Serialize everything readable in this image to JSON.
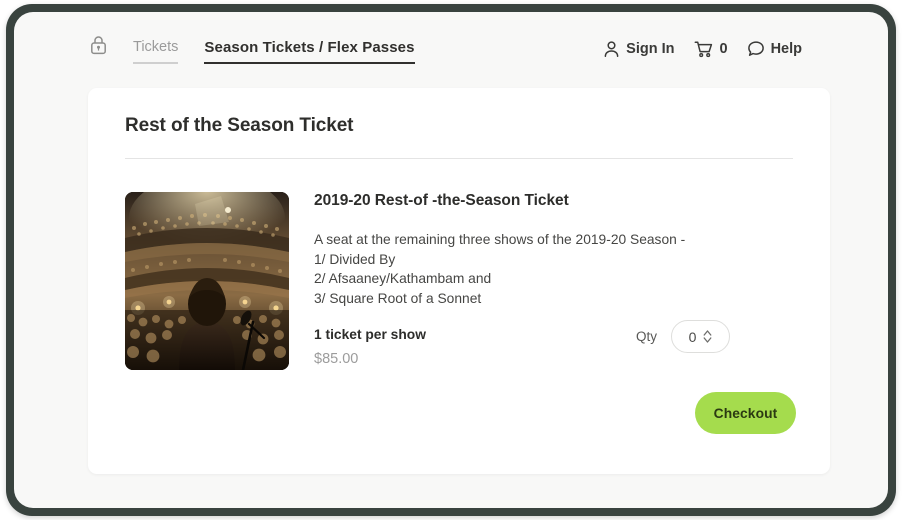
{
  "theme": {
    "frame_color": "#39433F",
    "page_background": "#F8F8F7",
    "card_background": "#FFFFFF",
    "accent_green": "#A5DC4D",
    "active_tab_color": "#31302E",
    "muted_text": "#9C9C9C"
  },
  "header": {
    "lock_icon": "padlock-icon",
    "tabs": [
      {
        "label": "Tickets",
        "active": false
      },
      {
        "label": "Season Tickets / Flex Passes",
        "active": true
      }
    ],
    "account": {
      "icon": "user-icon",
      "label": "Sign In"
    },
    "cart": {
      "icon": "shopping-cart-icon",
      "count": "0"
    },
    "help": {
      "icon": "speech-bubble-icon",
      "label": "Help"
    }
  },
  "card": {
    "title": "Rest of the Season Ticket"
  },
  "product": {
    "image_alt": "performer-on-stage-facing-theater-audience",
    "title": "2019-20 Rest-of -the-Season Ticket",
    "description_lines": [
      "A seat at the remaining three shows of the 2019-20 Season -",
      "1/ Divided By",
      "2/ Afsaaney/Kathambam and",
      "3/ Square Root of a Sonnet"
    ],
    "quantity_note": "1 ticket per show",
    "price": "$85.00"
  },
  "quantity": {
    "label": "Qty",
    "value": "0",
    "stepper_icon": "chevron-up-down-icon"
  },
  "actions": {
    "checkout_label": "Checkout"
  }
}
